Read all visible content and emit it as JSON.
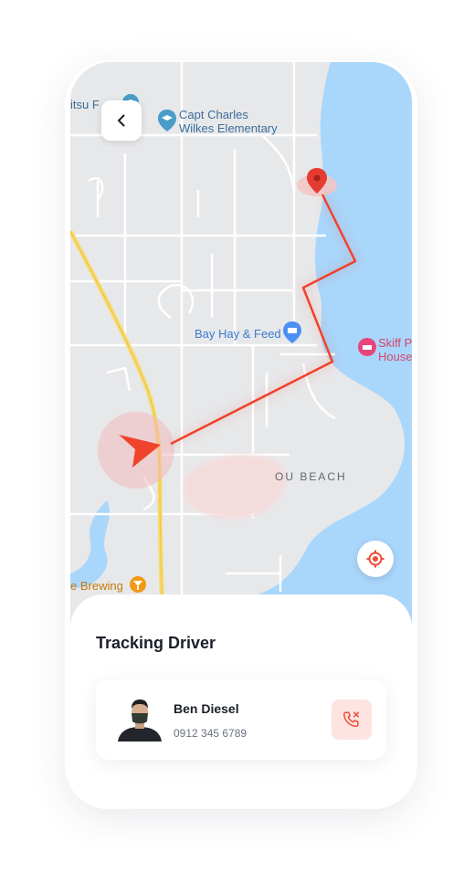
{
  "map": {
    "labels": {
      "partial_top_left": "itsu F",
      "school_line1": "Capt Charles",
      "school_line2": "Wilkes Elementary",
      "feed_store": "Bay Hay & Feed",
      "skiff_line1": "Skiff P",
      "skiff_line2": "House",
      "beach": "OU BEACH",
      "brewing": "e Brewing"
    },
    "colors": {
      "route": "#f0432c",
      "water": "#a9d6fb",
      "land": "#e7e8ea",
      "highway": "#f7dc6f",
      "school_icon": "#4a9cc9",
      "feed_icon": "#4b8ff2",
      "skiff_icon": "#e9457d",
      "brewing_icon": "#f29a16"
    },
    "icons": {
      "back": "chevron-left-icon",
      "destination": "map-pin-icon",
      "vehicle": "navigation-arrow-icon",
      "locate": "crosshair-icon"
    }
  },
  "tracking": {
    "title": "Tracking Driver",
    "driver": {
      "name": "Ben Diesel",
      "phone": "0912 345 6789"
    },
    "call_icon": "phone-cancel-icon",
    "accent": "#ef4a36"
  }
}
